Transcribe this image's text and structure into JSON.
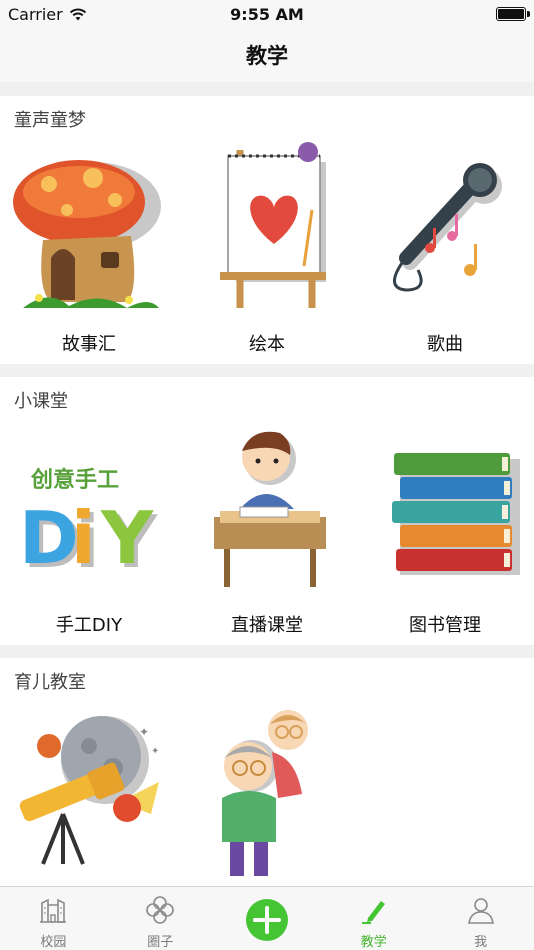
{
  "status_bar": {
    "carrier": "Carrier",
    "time": "9:55 AM"
  },
  "nav": {
    "title": "教学"
  },
  "sections": [
    {
      "title": "童声童梦",
      "items": [
        {
          "label": "故事汇"
        },
        {
          "label": "绘本"
        },
        {
          "label": "歌曲"
        }
      ]
    },
    {
      "title": "小课堂",
      "items": [
        {
          "label": "手工DIY"
        },
        {
          "label": "直播课堂"
        },
        {
          "label": "图书管理"
        }
      ]
    },
    {
      "title": "育儿教室",
      "items": [
        {
          "label": ""
        },
        {
          "label": ""
        }
      ]
    }
  ],
  "art_text": {
    "diy_banner": "创意手工",
    "diy_letters": "DIY"
  },
  "tabs": [
    {
      "label": "校园",
      "icon": "school-building-icon"
    },
    {
      "label": "圈子",
      "icon": "clover-icon"
    },
    {
      "label": "",
      "icon": "add-icon"
    },
    {
      "label": "教学",
      "icon": "pen-icon"
    },
    {
      "label": "我",
      "icon": "user-icon"
    }
  ],
  "active_tab": "教学",
  "colors": {
    "accent": "#45c534",
    "tab_inactive": "#7a7a7a",
    "background": "#f0f0f0"
  }
}
